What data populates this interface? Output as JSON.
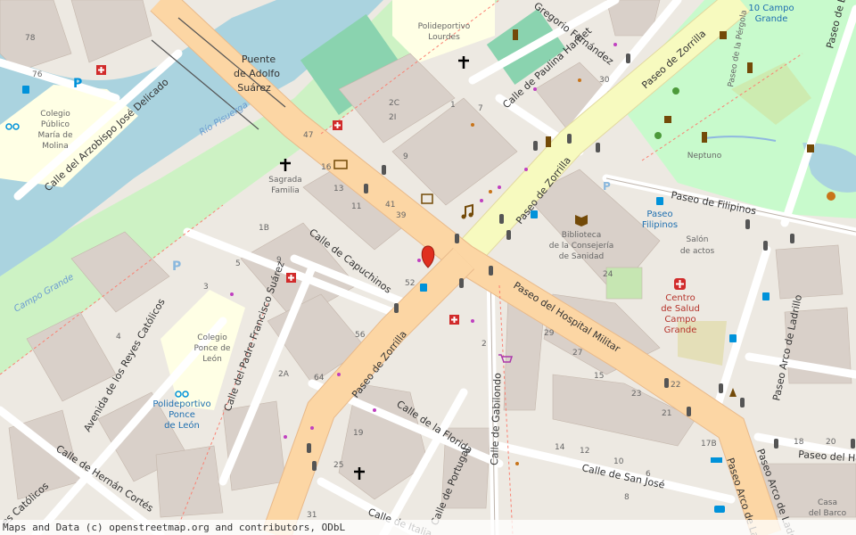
{
  "attribution": "Maps and Data (c) openstreetmap.org and contributors, ODbL",
  "colors": {
    "primary_road": "#fcd6a4",
    "secondary_road": "#f7fabf",
    "water": "#aad3df",
    "park": "#c8facc",
    "building": "#d9d0c9",
    "landuse": "#f2efe9",
    "school": "#ffffe5",
    "marker": "#e02f1f"
  },
  "streets": {
    "puente": [
      "Puente",
      "de Adolfo",
      "Suárez"
    ],
    "arzobispo": "Calle del Arzobispo José Delicado",
    "capuchinos": "Calle de Capuchinos",
    "padre_francisco": "Calle del Padre Francisco Suárez",
    "reyes_catolicos": "Avenida de los Reyes Católicos",
    "hernan_cortes": "Calle de Hernán Cortés",
    "catolicos_frag": "es Católicos",
    "zorrilla_s": "Paseo de Zorrilla",
    "zorrilla_n1": "Paseo de Zorrilla",
    "zorrilla_n2": "Paseo de Zorrilla",
    "hospital_militar": "Paseo del Hospital Militar",
    "florida": "Calle de la Florida",
    "gabilondo": "Calle de Gabilondo",
    "portugal": "Calle de Portugal",
    "italia": "Calle de Italia",
    "san_jose": "Calle de San José",
    "paulina": "Calle de Paulina Harriet",
    "gregorio": "Gregorio Fernández",
    "filipinos": "Paseo de Filipinos",
    "arco_ladrillo_1": "Paseo Arco de Ladrillo",
    "arco_ladrillo_2": "Paseo Arco de Ladrillo",
    "arco_ladrillo_3": "Paseo Arco de La",
    "belen": "Paseo de Belén",
    "del_hol": "Paseo del Hol",
    "pergola": "Paseo de la Pérgola"
  },
  "places": {
    "polideportivo_lourdes": [
      "Polideportivo",
      "Lourdes"
    ],
    "colegio_maria": [
      "Colegio",
      "Público",
      "María de",
      "Molina"
    ],
    "sagrada": [
      "Sagrada",
      "Familia"
    ],
    "colegio_ponce": [
      "Colegio",
      "Ponce de",
      "León"
    ],
    "polideportivo_ponce": [
      "Polideportivo",
      "Ponce",
      "de León"
    ],
    "biblioteca": [
      "Biblioteca",
      "de la Consejería",
      "de Sanidad"
    ],
    "paseo_filipinos_stop": [
      "Paseo",
      "Filipinos"
    ],
    "salon": [
      "Salón",
      "de actos"
    ],
    "centro_salud": [
      "Centro",
      "de Salud",
      "Campo",
      "Grande"
    ],
    "neptuno": "Neptuno",
    "campo_grande_num": [
      "10 Campo",
      "Grande"
    ],
    "casa_barco": [
      "Casa",
      "del Barco"
    ],
    "rio": "Río Pisuerga",
    "campo_grande_water": "Campo Grande"
  },
  "numbers": {
    "n78": "78",
    "n76": "76",
    "n47": "47",
    "n16": "16",
    "n13": "13",
    "n11": "11",
    "n9": "9",
    "n41": "41",
    "n39": "39",
    "n52": "52",
    "n56": "56",
    "n64": "64",
    "n2a": "2A",
    "n2c": "2C",
    "n2i": "2I",
    "n7": "7",
    "n1": "1",
    "n30": "30",
    "n24": "24",
    "n29": "29",
    "n27": "27",
    "n23": "23",
    "n22": "22",
    "n21": "21",
    "n17b": "17B",
    "n19": "19",
    "n25": "25",
    "n31": "31",
    "n14": "14",
    "n12": "12",
    "n10": "10",
    "n8": "8",
    "n6": "6",
    "n4": "4",
    "n3": "3",
    "n5": "5",
    "n18": "18",
    "n1b": "1B",
    "n20": "20",
    "n15": "15",
    "n9b": "9",
    "n2": "2"
  }
}
